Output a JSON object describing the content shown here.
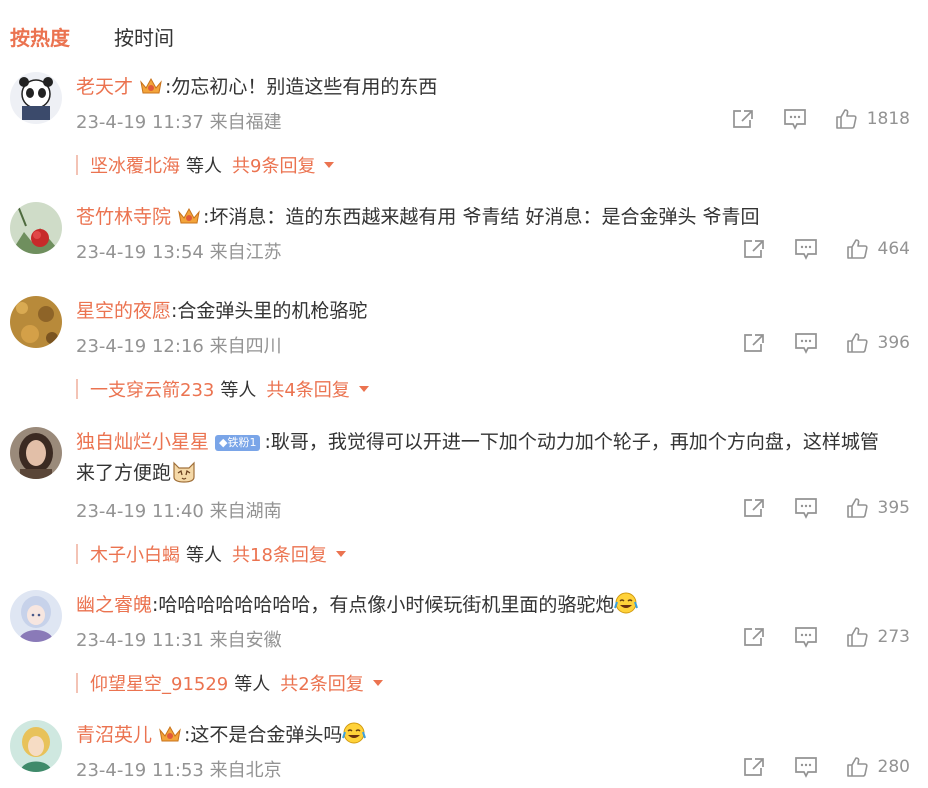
{
  "tabs": {
    "hot": "按热度",
    "time": "按时间"
  },
  "colors": {
    "accent": "#eb7350",
    "meta": "#939393",
    "text": "#333333"
  },
  "comments": [
    {
      "user": "老天才",
      "badge": "crown-badge-icon",
      "text": ":勿忘初心！别造这些有用的东西",
      "text2": "",
      "time": "23-4-19 11:37 来自福建",
      "likes": "1818",
      "reply_user": "坚冰覆北海",
      "reply_etc": "等人",
      "reply_total": "共9条回复"
    },
    {
      "user": "苍竹林寺院",
      "badge": "crown-badge-icon",
      "text": ":坏消息：造的东西越来越有用 爷青结 好消息：是合金弹头 爷青回",
      "text2": "",
      "time": "23-4-19 13:54 来自江苏",
      "likes": "464"
    },
    {
      "user": "星空的夜愿",
      "text": ":合金弹头里的机枪骆驼",
      "time": "23-4-19 12:16 来自四川",
      "likes": "396",
      "reply_user": "一支穿云箭233",
      "reply_etc": "等人",
      "reply_total": "共4条回复"
    },
    {
      "user": "独自灿烂小星星",
      "fan_badge": "铁粉1",
      "text": ":耿哥，我觉得可以开进一下加个动力加个轮子，再加个方向盘，这样城管",
      "text2": "来了方便跑",
      "time": "23-4-19 11:40 来自湖南",
      "likes": "395",
      "reply_user": "木子小白蝎",
      "reply_etc": "等人",
      "reply_total": "共18条回复"
    },
    {
      "user": "幽之睿魄",
      "text": ":哈哈哈哈哈哈哈哈，有点像小时候玩街机里面的骆驼炮",
      "time": "23-4-19 11:31 来自安徽",
      "likes": "273",
      "reply_user": "仰望星空_91529",
      "reply_etc": "等人",
      "reply_total": "共2条回复"
    },
    {
      "user": "青沼英儿",
      "badge": "crown-badge-icon",
      "text": ":这不是合金弹头吗",
      "time": "23-4-19 11:53 来自北京",
      "likes": "280"
    }
  ]
}
